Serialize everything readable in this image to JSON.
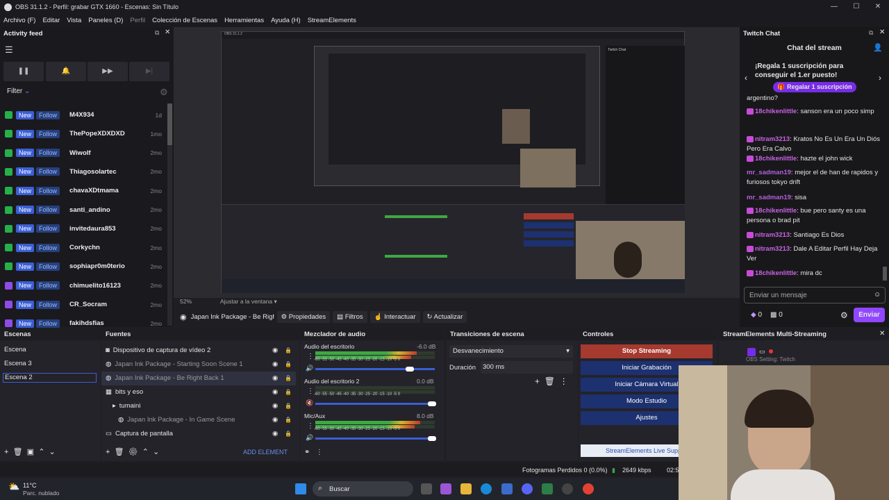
{
  "window": {
    "title": "OBS 31.1.2 - Perfil: grabar GTX 1660 - Escenas: Sin Título",
    "min": "—",
    "max": "☐",
    "close": "✕"
  },
  "menu": [
    "Archivo (F)",
    "Editar",
    "Vista",
    "Paneles (D)",
    "Perfil",
    "Colección de Escenas",
    "Herramientas",
    "Ayuda (H)",
    "StreamElements"
  ],
  "activity": {
    "title": "Activity feed",
    "filter": "Filter",
    "new_label": "New",
    "follow_label": "Follow",
    "items": [
      {
        "name": "M4X934",
        "time": "1d"
      },
      {
        "name": "ThePopeXDXDXD",
        "time": "1mo"
      },
      {
        "name": "Wiwolf",
        "time": "2mo"
      },
      {
        "name": "Thiagosolartec",
        "time": "2mo"
      },
      {
        "name": "chavaXDtmama",
        "time": "2mo"
      },
      {
        "name": "santi_andino",
        "time": "2mo"
      },
      {
        "name": "invitedaura853",
        "time": "2mo"
      },
      {
        "name": "Corkychn",
        "time": "2mo"
      },
      {
        "name": "sophiapr0m0terio",
        "time": "2mo"
      },
      {
        "name": "chimuelito16123",
        "time": "2mo"
      },
      {
        "name": "CR_Socram",
        "time": "2mo"
      },
      {
        "name": "fakihdsfias",
        "time": "2mo"
      }
    ]
  },
  "chat": {
    "dock_title": "Twitch Chat",
    "title": "Chat del stream",
    "promo": "¡Regala 1 suscripción para conseguir el 1.er puesto!",
    "promo_btn": "Regalar 1 suscripción",
    "prev_line": "argentino?",
    "messages": [
      {
        "user": "18chikenlittle",
        "text": "sanson era un poco simp",
        "badge": true
      },
      {
        "user": "nitram3213",
        "text": "Kratos No Es Un Era Un Diós Pero Era Calvo",
        "badge": true
      },
      {
        "user": "18chikenlittle",
        "text": "hazte el john wick",
        "badge": true
      },
      {
        "user": "mr_sadman19",
        "text": "mejor el de han de rapidos y furiosos tokyo drift",
        "badge": false
      },
      {
        "user": "mr_sadman19",
        "text": "sisa",
        "badge": false
      },
      {
        "user": "18chikenlittle",
        "text": "bue pero santy es una persona o brad pit",
        "badge": true
      },
      {
        "user": "nitram3213",
        "text": "Santiago Es Dios",
        "badge": true
      },
      {
        "user": "nitram3213",
        "text": "Dale A Editar Perfil Hay Deja Ver",
        "badge": true
      },
      {
        "user": "18chikenlittle",
        "text": "mira dc",
        "badge": true
      }
    ],
    "input_placeholder": "Enviar un mensaje",
    "points": "0",
    "points2": "0",
    "send": "Enviar"
  },
  "preview": {
    "zoom": "52%",
    "fit": "Ajustar a la ventana"
  },
  "source_bar": {
    "source": "Japan Ink Package - Be Righ",
    "props": "Propiedades",
    "filters": "Filtros",
    "interact": "Interactuar",
    "refresh": "Actualizar"
  },
  "scenes": {
    "title": "Escenas",
    "items": [
      "Escena",
      "Escena 3",
      "Escena 2"
    ]
  },
  "sources": {
    "title": "Fuentes",
    "items": [
      "Dispositivo de captura de vídeo 2",
      "Japan Ink Package - Starting Soon Scene 1",
      "Japan Ink Package - Be Right Back 1",
      "bits y eso",
      "tumaini",
      "Japan Ink Package - In Game Scene",
      "Captura de pantalla"
    ],
    "add": "ADD ELEMENT"
  },
  "mixer": {
    "title": "Mezclador de audio",
    "channels": [
      {
        "name": "Audio del escritorio",
        "db": "-6.0 dB"
      },
      {
        "name": "Audio del escritorio 2",
        "db": "0.0 dB"
      },
      {
        "name": "Mic/Aux",
        "db": "8.0 dB"
      }
    ],
    "scale": "-60 -55 -50 -45 -40 -35 -30 -25 -20 -15 -10 -5 0"
  },
  "transitions": {
    "title": "Transiciones de escena",
    "type": "Desvanecimiento",
    "duration_label": "Duración",
    "duration": "300 ms"
  },
  "controls": {
    "title": "Controles",
    "buttons": [
      "Stop Streaming",
      "Iniciar Grabación",
      "Iniciar Cámara Virtual",
      "Modo Estudio",
      "Ajustes"
    ]
  },
  "se": {
    "title": "StreamElements Multi-Streaming",
    "setting": "OBS Setting: Twitch",
    "live": "StreamElements Live Supp"
  },
  "status": {
    "frames": "Fotogramas Perdidos 0 (0.0%)",
    "kbps": "2649 kbps",
    "time": "02:5"
  },
  "taskbar": {
    "temp": "11°C",
    "weather": "Parc. nublado",
    "search": "Buscar"
  }
}
